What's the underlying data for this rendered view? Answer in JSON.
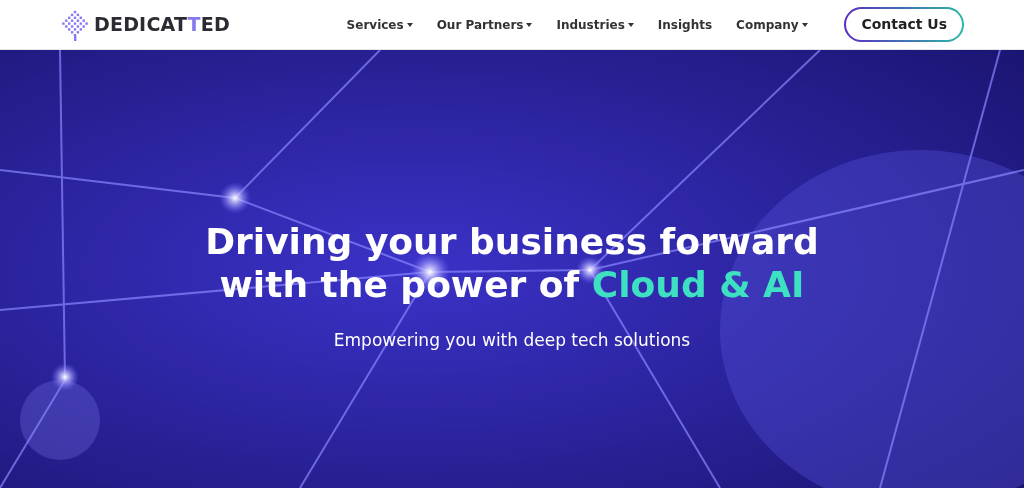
{
  "logo": {
    "parts": [
      {
        "text": "DEDICAT",
        "accent": false
      },
      {
        "text": "T",
        "accent": true
      },
      {
        "text": "ED",
        "accent": false
      }
    ]
  },
  "nav": [
    {
      "label": "Services",
      "dropdown": true
    },
    {
      "label": "Our Partners",
      "dropdown": true
    },
    {
      "label": "Industries",
      "dropdown": true
    },
    {
      "label": "Insights",
      "dropdown": false
    },
    {
      "label": "Company",
      "dropdown": true
    }
  ],
  "contact_button": "Contact Us",
  "hero": {
    "headline_lines": [
      "Driving your business forward",
      "with the power of "
    ],
    "headline_highlight": "Cloud & AI",
    "subtitle": "Empowering you with deep tech solutions"
  }
}
